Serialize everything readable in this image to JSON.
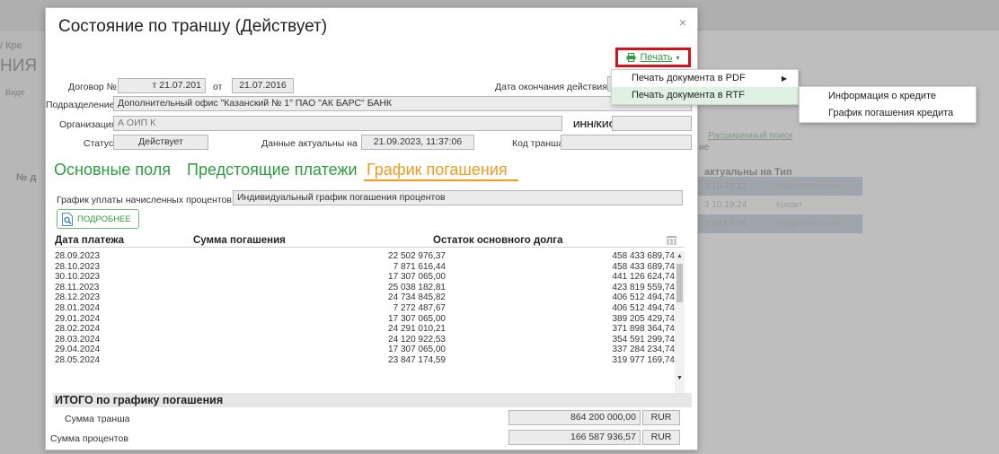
{
  "background": {
    "crumb": "/ Кре",
    "heading": "НИЯ",
    "left_label": "Виде",
    "no_label": "№ д",
    "adv_search": "Расширенный поиск",
    "col_header": "актуальны на Тип",
    "small_label": "ие",
    "rows": [
      {
        "time": "3 10:19:13",
        "type": "Кредитная линия"
      },
      {
        "time": "3 10:19:24",
        "type": "Кредит"
      },
      {
        "time": "9 08:09:06",
        "type": "Кредитная линия"
      }
    ]
  },
  "modal": {
    "title": "Состояние по траншу (Действует)",
    "close": "×",
    "print_label": "Печать",
    "print_caret": "▾",
    "form": {
      "contract_label": "Договор №",
      "contract_value": "т 21.07.201",
      "from_label": "от",
      "from_value": "21.07.2016",
      "end_date_label": "Дата окончания действия",
      "end_date_value": "",
      "division_label": "Подразделение",
      "division_value": "Дополнительный офис \"Казанский № 1\" ПАО \"АК БАРС\" БАНК",
      "org_label": "Организация",
      "org_value": "А ОИП К",
      "inn_label": "ИНН/КИО",
      "inn_value": "",
      "status_label": "Статус",
      "status_value": "Действует",
      "actual_label": "Данные актуальны на",
      "actual_value": "21.09.2023, 11:37:06",
      "tranche_code_label": "Код транша",
      "tranche_code_value": ""
    },
    "tabs": [
      "Основные поля",
      "Предстоящие платежи",
      "График погашения"
    ],
    "interest_label": "График уплаты начисленных процентов",
    "interest_value": "Индивидуальный график погашения процентов",
    "more_label": "ПОДРОБНЕЕ",
    "grid": {
      "headers": [
        "Дата платежа",
        "Сумма погашения",
        "Остаток основного долга"
      ],
      "rows": [
        {
          "date": "28.09.2023",
          "sum": "22 502 976,37",
          "rest": "458 433 689,74"
        },
        {
          "date": "28.10.2023",
          "sum": "7 871 616,44",
          "rest": "458 433 689,74"
        },
        {
          "date": "30.10.2023",
          "sum": "17 307 065,00",
          "rest": "441 126 624,74"
        },
        {
          "date": "28.11.2023",
          "sum": "25 038 182,81",
          "rest": "423 819 559,74"
        },
        {
          "date": "28.12.2023",
          "sum": "24 734 845,82",
          "rest": "406 512 494,74"
        },
        {
          "date": "28.01.2024",
          "sum": "7 272 487,67",
          "rest": "406 512 494,74"
        },
        {
          "date": "29.01.2024",
          "sum": "17 307 065,00",
          "rest": "389 205 429,74"
        },
        {
          "date": "28.02.2024",
          "sum": "24 291 010,21",
          "rest": "371 898 364,74"
        },
        {
          "date": "28.03.2024",
          "sum": "24 120 922,53",
          "rest": "354 591 299,74"
        },
        {
          "date": "29.04.2024",
          "sum": "17 307 065,00",
          "rest": "337 284 234,74"
        },
        {
          "date": "28.05.2024",
          "sum": "23 847 174,59",
          "rest": "319 977 169,74"
        }
      ]
    },
    "totals": {
      "title": "ИТОГО по графику погашения",
      "tranche_label": "Сумма транша",
      "tranche_value": "864 200 000,00",
      "tranche_currency": "RUR",
      "interest_label": "Сумма процентов",
      "interest_value": "166 587 936,57",
      "interest_currency": "RUR"
    }
  },
  "print_menu": {
    "items": [
      {
        "label": "Печать документа в PDF",
        "caret": "▶"
      },
      {
        "label": "Печать документа в RTF",
        "caret": ""
      }
    ]
  },
  "rtf_submenu": {
    "items": [
      "Информация о кредите",
      "График погашения кредита"
    ]
  },
  "colors": {
    "accent_green": "#2a9d3e",
    "active_tab": "#f39a1e",
    "highlight_box": "#d0141b"
  }
}
